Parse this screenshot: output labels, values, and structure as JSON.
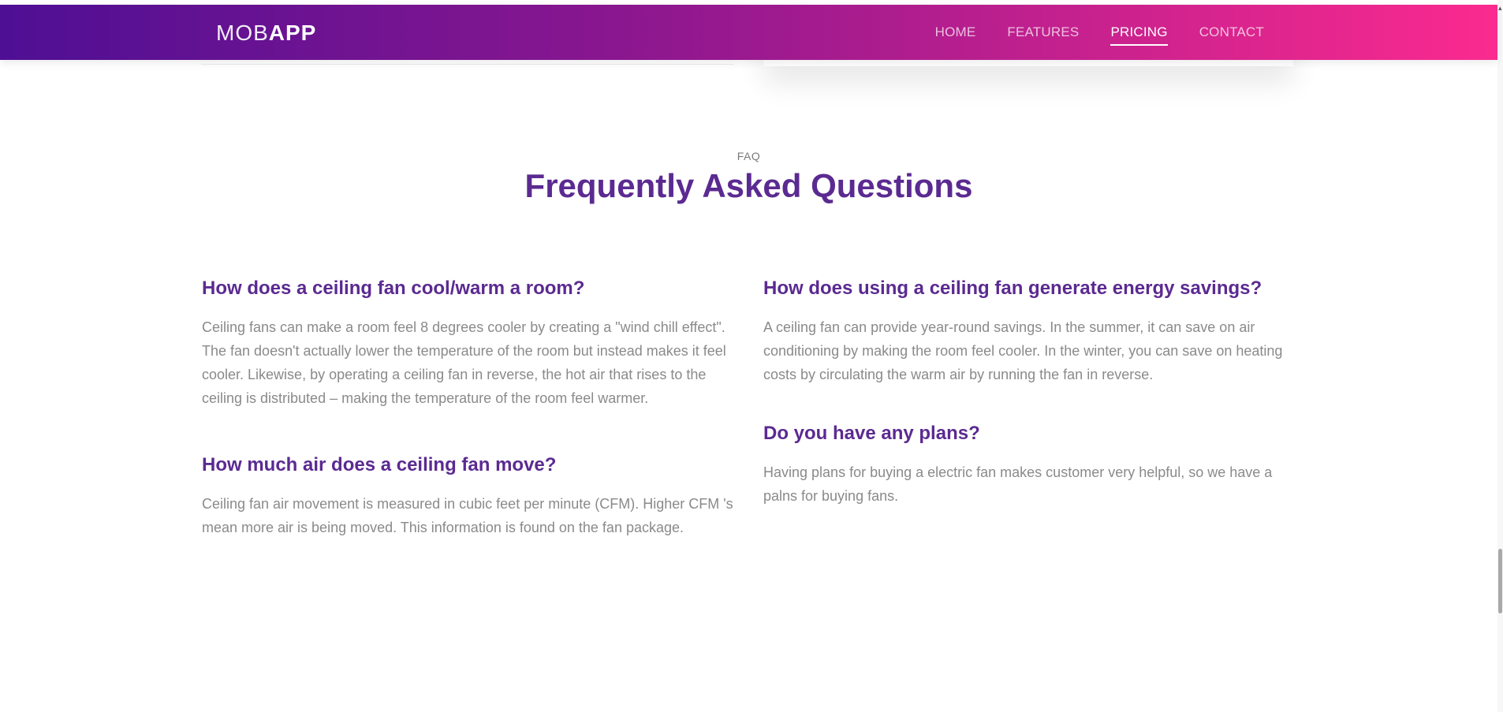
{
  "header": {
    "brand_light": "MOB",
    "brand_bold": "APP",
    "nav": [
      {
        "label": "HOME"
      },
      {
        "label": "FEATURES"
      },
      {
        "label": "PRICING"
      },
      {
        "label": "CONTACT"
      }
    ],
    "active_nav": "PRICING"
  },
  "faq": {
    "label": "FAQ",
    "title": "Frequently Asked Questions",
    "left": [
      {
        "question": "How does a ceiling fan cool/warm a room?",
        "answer": "Ceiling fans can make a room feel 8 degrees cooler by creating a \"wind chill effect\". The fan doesn't actually lower the temperature of the room but instead makes it feel cooler. Likewise, by operating a ceiling fan in reverse, the hot air that rises to the ceiling is distributed – making the temperature of the room feel warmer."
      },
      {
        "question": "How much air does a ceiling fan move?",
        "answer": "Ceiling fan air movement is measured in cubic feet per minute (CFM). Higher CFM 's mean more air is being moved. This information is found on the fan package."
      }
    ],
    "right": [
      {
        "question": "How does using a ceiling fan generate energy savings?",
        "answer": "A ceiling fan can provide year-round savings. In the summer, it can save on air conditioning by making the room feel cooler. In the winter, you can save on heating costs by circulating the warm air by running the fan in reverse."
      },
      {
        "question": "Do you have any plans?",
        "answer": "Having plans for buying a electric fan makes customer very helpful, so we have a palns for buying fans."
      }
    ]
  },
  "colors": {
    "accent": "#5b2a91",
    "gradient_start": "#4e0f94",
    "gradient_end": "#fb2a8f",
    "body_text": "#8a8a8a"
  }
}
